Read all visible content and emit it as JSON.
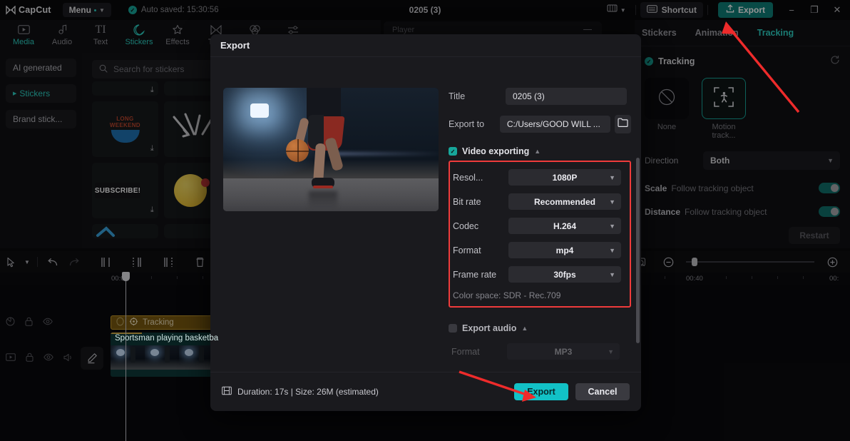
{
  "topbar": {
    "brand": "CapCut",
    "menu_label": "Menu",
    "autosave": "Auto saved: 15:30:56",
    "project_title": "0205 (3)",
    "shortcut_label": "Shortcut",
    "export_label": "Export",
    "minimize": "−",
    "maximize": "❐",
    "close": "✕"
  },
  "material_tabs": [
    {
      "label": "Media",
      "icon": "media-icon",
      "active": false
    },
    {
      "label": "Audio",
      "icon": "audio-icon",
      "active": false
    },
    {
      "label": "Text",
      "icon": "text-icon",
      "active": false
    },
    {
      "label": "Stickers",
      "icon": "stickers-icon",
      "active": true
    },
    {
      "label": "Effects",
      "icon": "effects-icon",
      "active": false
    },
    {
      "label": "Tran",
      "icon": "transitions-icon",
      "active": false
    },
    {
      "label": "",
      "icon": "filters-icon",
      "active": false
    },
    {
      "label": "",
      "icon": "adjustment-icon",
      "active": false
    }
  ],
  "left_categories": [
    {
      "label": "AI generated",
      "selected": false
    },
    {
      "label": "Stickers",
      "selected": true
    },
    {
      "label": "Brand stick...",
      "selected": false
    }
  ],
  "stickers": {
    "search_placeholder": "Search for stickers",
    "items": [
      {
        "name": "long-weekend-sticker",
        "label": "LONG WEEKEND"
      },
      {
        "name": "arrows-sticker",
        "label": ""
      },
      {
        "name": "subscribe-sticker",
        "label": "SUBSCRIBE!"
      },
      {
        "name": "emoji-kiss-sticker",
        "label": ""
      }
    ]
  },
  "player": {
    "label": "Player"
  },
  "right_panel": {
    "tabs": [
      {
        "label": "Stickers",
        "active": false
      },
      {
        "label": "Animation",
        "active": false
      },
      {
        "label": "Tracking",
        "active": true
      }
    ],
    "section_title": "Tracking",
    "tiles": [
      {
        "label": "None",
        "icon": "none-icon",
        "selected": false
      },
      {
        "label": "Motion track...",
        "icon": "motion-tracking-icon",
        "selected": true
      }
    ],
    "direction_label": "Direction",
    "direction_value": "Both",
    "scale_label": "Scale",
    "scale_sub": "Follow tracking object",
    "scale_on": true,
    "distance_label": "Distance",
    "distance_sub": "Follow tracking object",
    "distance_on": true,
    "restart_label": "Restart"
  },
  "timeline": {
    "tools": [
      "select-icon",
      "undo-icon",
      "redo-icon",
      "split-left-icon",
      "split-icon",
      "split-right-icon",
      "delete-icon",
      "freeze-icon"
    ],
    "right_tools": [
      "auto-cut-icon",
      "link-icon",
      "mirror-icon",
      "crop-icon",
      "zoom-out-icon",
      "zoom-in-icon"
    ],
    "ruler_marks": [
      "00:00",
      "00:40",
      "00:"
    ],
    "tracks": [
      {
        "name": "tracking-clip",
        "label": "Tracking"
      },
      {
        "name": "video-clip",
        "label": "Sportsman playing basketba"
      }
    ]
  },
  "export_dialog": {
    "title": "Export",
    "title_label": "Title",
    "title_value": "0205 (3)",
    "exportto_label": "Export to",
    "exportto_value": "C:/Users/GOOD WILL ...",
    "video_section": "Video exporting",
    "video_checked": true,
    "options": [
      {
        "label": "Resol...",
        "value": "1080P"
      },
      {
        "label": "Bit rate",
        "value": "Recommended"
      },
      {
        "label": "Codec",
        "value": "H.264"
      },
      {
        "label": "Format",
        "value": "mp4"
      },
      {
        "label": "Frame rate",
        "value": "30fps"
      }
    ],
    "color_space": "Color space: SDR - Rec.709",
    "audio_section": "Export audio",
    "audio_checked": false,
    "audio_format_label": "Format",
    "audio_format_value": "MP3",
    "footer_info": "Duration: 17s | Size: 26M (estimated)",
    "export_button": "Export",
    "cancel_button": "Cancel"
  },
  "colors": {
    "accent_teal": "#2dd3c6",
    "export_btn": "#12c1c6",
    "highlight_red": "#ef3b3b",
    "clip_yellow": "#c79a2a"
  }
}
